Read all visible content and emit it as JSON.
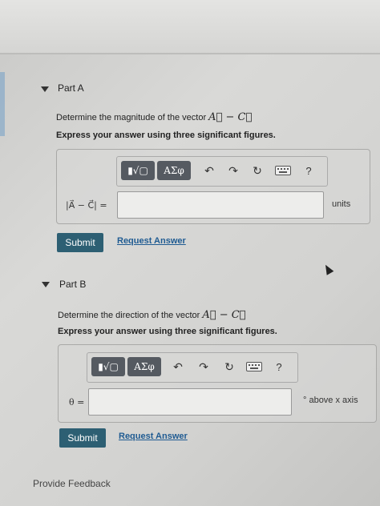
{
  "partA": {
    "label": "Part A",
    "question_prefix": "Determine the magnitude of the vector ",
    "math": "A⃗ − C⃗",
    "instruction": "Express your answer using three significant figures.",
    "toolbar": {
      "templates_label": "▮√▢",
      "greek_label": "ΑΣφ",
      "help_label": "?"
    },
    "answer_label": "|A⃗ − C⃗| =",
    "input_value": "",
    "units": "units",
    "submit_label": "Submit",
    "request_label": "Request Answer"
  },
  "partB": {
    "label": "Part B",
    "question_prefix": "Determine the direction of the vector ",
    "math": "A⃗ − C⃗",
    "instruction": "Express your answer using three significant figures.",
    "toolbar": {
      "templates_label": "▮√▢",
      "greek_label": "ΑΣφ",
      "help_label": "?"
    },
    "answer_label": "θ =",
    "input_value": "",
    "units": "° above x axis",
    "submit_label": "Submit",
    "request_label": "Request Answer"
  },
  "footer": {
    "feedback_label": "Provide Feedback"
  }
}
